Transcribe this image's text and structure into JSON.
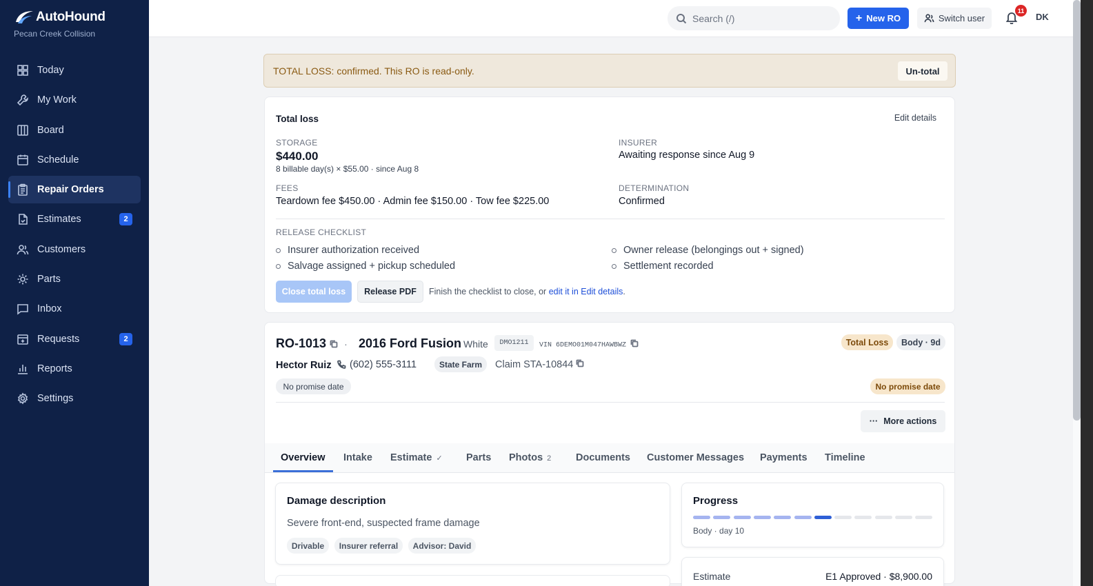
{
  "brand": {
    "name": "AutoHound",
    "subtitle": "Pecan Creek Collision"
  },
  "sidebar": {
    "items": [
      {
        "label": "Today",
        "icon": "grid-icon"
      },
      {
        "label": "My Work",
        "icon": "wrench-icon"
      },
      {
        "label": "Board",
        "icon": "columns-icon"
      },
      {
        "label": "Schedule",
        "icon": "calendar-icon"
      },
      {
        "label": "Repair Orders",
        "icon": "clipboard-icon",
        "active": true
      },
      {
        "label": "Estimates",
        "icon": "file-icon",
        "badge": "2"
      },
      {
        "label": "Customers",
        "icon": "users-icon"
      },
      {
        "label": "Parts",
        "icon": "gear-icon"
      },
      {
        "label": "Inbox",
        "icon": "message-icon"
      },
      {
        "label": "Requests",
        "icon": "calendar-plus-icon",
        "badge": "2"
      },
      {
        "label": "Reports",
        "icon": "bar-chart-icon"
      },
      {
        "label": "Settings",
        "icon": "settings-icon"
      }
    ]
  },
  "topbar": {
    "search_placeholder": "Search (/)",
    "new_ro_label": "New RO",
    "switch_user_label": "Switch user",
    "notification_count": "11",
    "avatar_initials": "DK"
  },
  "banner": {
    "text": "TOTAL LOSS: confirmed. This RO is read-only.",
    "button_label": "Un-total"
  },
  "total_loss": {
    "title": "Total loss",
    "edit_label": "Edit details",
    "storage_label": "STORAGE",
    "storage_amount": "$440.00",
    "storage_detail": "8 billable day(s) × $55.00 · since Aug 8",
    "insurer_label": "INSURER",
    "insurer_value": "Awaiting response since Aug 9",
    "fees_label": "FEES",
    "fees_value": "Teardown fee $450.00 · Admin fee $150.00 · Tow fee $225.00",
    "determination_label": "DETERMINATION",
    "determination_value": "Confirmed",
    "checklist_label": "RELEASE CHECKLIST",
    "checklist": [
      "Insurer authorization received",
      "Owner release (belongings out + signed)",
      "Salvage assigned + pickup scheduled",
      "Settlement recorded"
    ],
    "close_label": "Close total loss",
    "pdf_label": "Release PDF",
    "hint_prefix": "Finish the checklist to close, or ",
    "hint_link": "edit it in Edit details",
    "hint_suffix": "."
  },
  "ro": {
    "number": "RO-1013",
    "separator": "·",
    "vehicle": "2016 Ford Fusion",
    "color": "White",
    "plate": "DMO1211",
    "vin": "VIN 6DEMO01M047HAWBWZ",
    "tag_status": "Total Loss",
    "tag_stage": "Body · 9d",
    "customer": "Hector Ruiz",
    "phone": "(602) 555-3111",
    "insurer": "State Farm",
    "claim": "Claim STA-10844",
    "promise_left": "No promise date",
    "promise_right": "No promise date",
    "more_actions": "More actions",
    "more_glyph": "···"
  },
  "tabs": [
    {
      "label": "Overview",
      "active": true
    },
    {
      "label": "Intake"
    },
    {
      "label": "Estimate",
      "mark": "✓"
    },
    {
      "label": "Parts"
    },
    {
      "label": "Photos",
      "mark": "2"
    },
    {
      "label": "Documents"
    },
    {
      "label": "Customer Messages"
    },
    {
      "label": "Payments"
    },
    {
      "label": "Timeline"
    }
  ],
  "damage": {
    "title": "Damage description",
    "text": "Severe front-end, suspected frame damage",
    "chips": [
      "Drivable",
      "Insurer referral",
      "Advisor: David"
    ]
  },
  "progress": {
    "title": "Progress",
    "total_segments": 12,
    "completed_segments": 6,
    "current_segment": 7,
    "subtitle": "Body · day 10"
  },
  "estimate_summary": {
    "label": "Estimate",
    "value": "E1 Approved · $8,900.00"
  },
  "colors": {
    "sidebar": "#0f2147",
    "accent": "#2563eb",
    "warning_bg": "#efe8dc",
    "warning_text": "#8a5a12"
  }
}
